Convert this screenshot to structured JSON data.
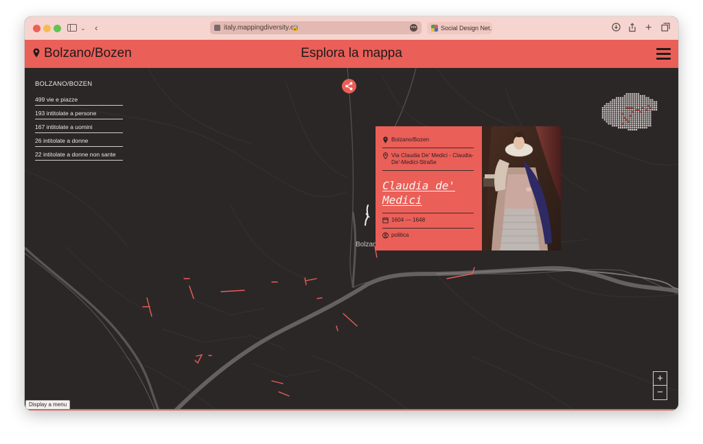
{
  "browser": {
    "url": "italy.mappingdiversity.eu",
    "second_tab_title": "Social Design Net..."
  },
  "header": {
    "city": "Bolzano/Bozen",
    "title": "Esplora la mappa"
  },
  "stats": {
    "title": "BOLZANO/BOZEN",
    "rows": [
      "499 vie e piazze",
      "193 intitolate a persone",
      "167 intitolate a uomini",
      "26 intitolate a donne",
      "22 intitolate a donne non sante"
    ]
  },
  "card": {
    "city": "Bolzano/Bozen",
    "street": "Via Claudia De' Medici - Claudia-De'-Medici-Straße",
    "name": "Claudia de' Medici",
    "years": "1604 — 1648",
    "category": "politica"
  },
  "map": {
    "label": "Bolzano"
  },
  "zoom": {
    "in": "+",
    "out": "−"
  },
  "tooltip": "Display a menu",
  "colors": {
    "accent": "#ea5f58",
    "map_background": "#2b2727",
    "chrome": "#f6d4cf"
  }
}
